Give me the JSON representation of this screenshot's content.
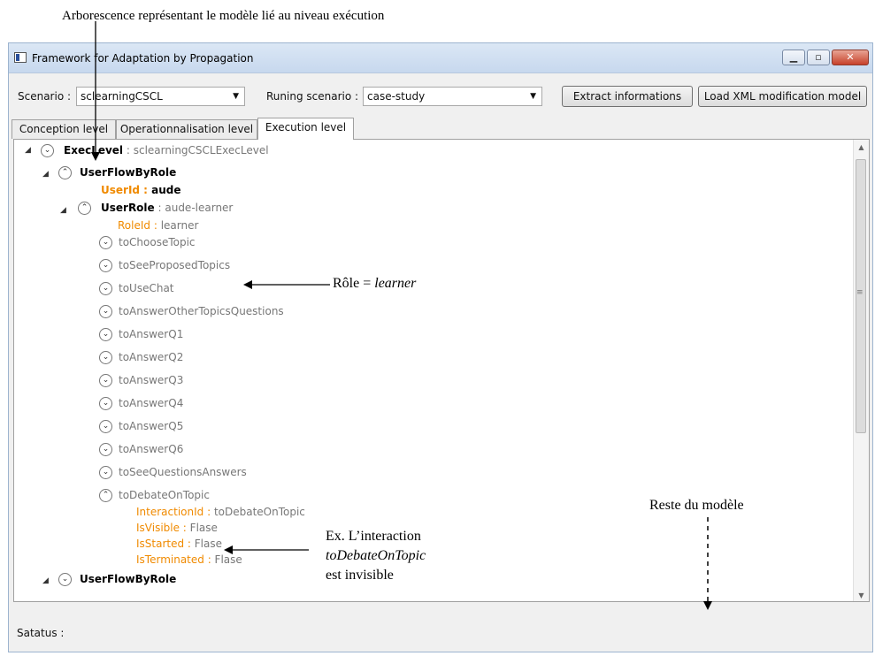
{
  "annotations": {
    "top": "Arborescence représentant le modèle lié au niveau exécution",
    "role": "Rôle = ",
    "role_value": "learner",
    "rest": "Reste du modèle",
    "ex1": "Ex. L’interaction",
    "ex2": "toDebateOnTopic",
    "ex3": "est invisible"
  },
  "window": {
    "title": "Framework for Adaptation by Propagation"
  },
  "toolbar": {
    "scenario_label": "Scenario :",
    "scenario_value": "sclearningCSCL",
    "running_label": "Runing scenario :",
    "running_value": "case-study",
    "extract_label": "Extract informations",
    "load_label": "Load XML modification model"
  },
  "tabs": [
    "Conception level",
    "Operationnalisation level",
    "Execution level"
  ],
  "tree": {
    "root_key": "ExecLevel",
    "root_val": " : sclearningCSCLExecLevel",
    "flow_label": "UserFlowByRole",
    "userid_key": "UserId : ",
    "userid_val": "aude",
    "role_key": "UserRole",
    "role_val": " : aude-learner",
    "roleid_key": "RoleId : ",
    "roleid_val": "learner",
    "items": [
      "toChooseTopic",
      "toSeeProposedTopics",
      "toUseChat",
      "toAnswerOtherTopicsQuestions",
      "toAnswerQ1",
      "toAnswerQ2",
      "toAnswerQ3",
      "toAnswerQ4",
      "toAnswerQ5",
      "toAnswerQ6",
      "toSeeQuestionsAnswers",
      "toDebateOnTopic"
    ],
    "props": [
      {
        "key": "InteractionId : ",
        "val": "toDebateOnTopic"
      },
      {
        "key": "IsVisible : ",
        "val": "Flase"
      },
      {
        "key": "IsStarted : ",
        "val": "Flase"
      },
      {
        "key": "IsTerminated : ",
        "val": "Flase"
      }
    ],
    "flow2_label": "UserFlowByRole"
  },
  "status": {
    "label": "Satatus :"
  }
}
